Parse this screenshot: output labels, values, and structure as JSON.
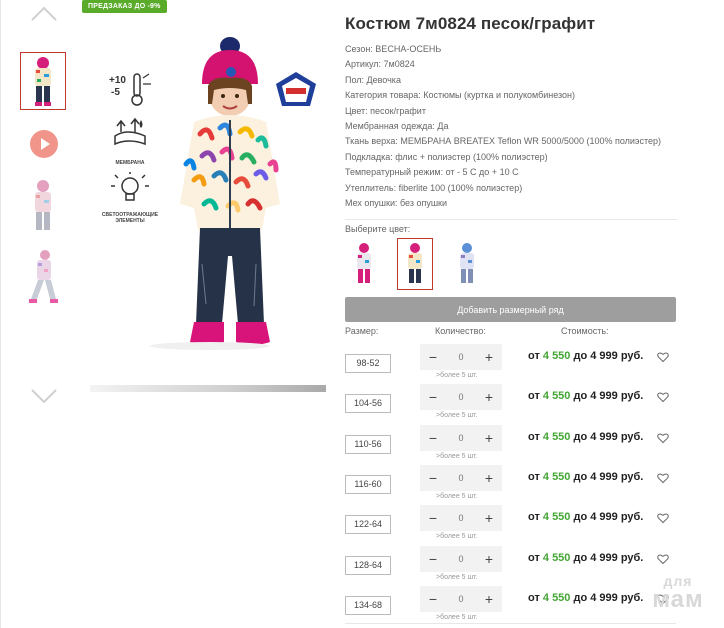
{
  "gallery": {
    "promo_badge": "ПРЕДЗАКАЗ ДО -9%",
    "features": [
      {
        "name": "thermometer-icon",
        "caption": "+10\n-5"
      },
      {
        "name": "membrane-icon",
        "caption": "МЕМБРАНА"
      },
      {
        "name": "reflective-icon",
        "caption": "СВЕТООТРАЖАЮЩИЕ ЭЛЕМЕНТЫ"
      }
    ]
  },
  "product": {
    "title": "Костюм 7м0824 песок/графит",
    "attributes": [
      "Сезон: ВЕСНА-ОСЕНЬ",
      "Артикул: 7м0824",
      "Пол: Девочка",
      "Категория товара: Костюмы (куртка и полукомбинезон)",
      "Цвет: песок/графит",
      "Мембранная одежда: Да",
      "Ткань верха: МЕМБРАНА BREATEX Teflon WR 5000/5000 (100% полиэстер)",
      "Подкладка: флис + полиэстер (100% полиэстер)",
      "Температурный режим: от - 5 С до + 10 С",
      "Утеплитель: fiberlite 100 (100% полиэстер)",
      "Мех опушки: без опушки"
    ],
    "choose_color_label": "Выберите цвет:",
    "add_row_label": "Добавить размерный ряд"
  },
  "table": {
    "headers": {
      "size": "Размер:",
      "qty": "Количество:",
      "price": "Стоимость:"
    },
    "rows": [
      {
        "size": "98-52",
        "qty": "0",
        "more": ">более 5 шт.",
        "from": "от ",
        "price_low": "4 550",
        "to": " до 4 999 руб."
      },
      {
        "size": "104-56",
        "qty": "0",
        "more": ">более 5 шт.",
        "from": "от ",
        "price_low": "4 550",
        "to": " до 4 999 руб."
      },
      {
        "size": "110-56",
        "qty": "0",
        "more": ">более 5 шт.",
        "from": "от ",
        "price_low": "4 550",
        "to": " до 4 999 руб."
      },
      {
        "size": "116-60",
        "qty": "0",
        "more": ">более 5 шт.",
        "from": "от ",
        "price_low": "4 550",
        "to": " до 4 999 руб."
      },
      {
        "size": "122-64",
        "qty": "0",
        "more": ">более 5 шт.",
        "from": "от ",
        "price_low": "4 550",
        "to": " до 4 999 руб."
      },
      {
        "size": "128-64",
        "qty": "0",
        "more": ">более 5 шт.",
        "from": "от ",
        "price_low": "4 550",
        "to": " до 4 999 руб."
      },
      {
        "size": "134-68",
        "qty": "0",
        "more": ">более 5 шт.",
        "from": "от ",
        "price_low": "4 550",
        "to": " до 4 999 руб."
      }
    ]
  },
  "watermark": {
    "line1": "для",
    "line2": "мам"
  },
  "colors": {
    "accent_green": "#43a533",
    "selected_border": "#c0392b",
    "button_gray": "#9e9e9e"
  }
}
